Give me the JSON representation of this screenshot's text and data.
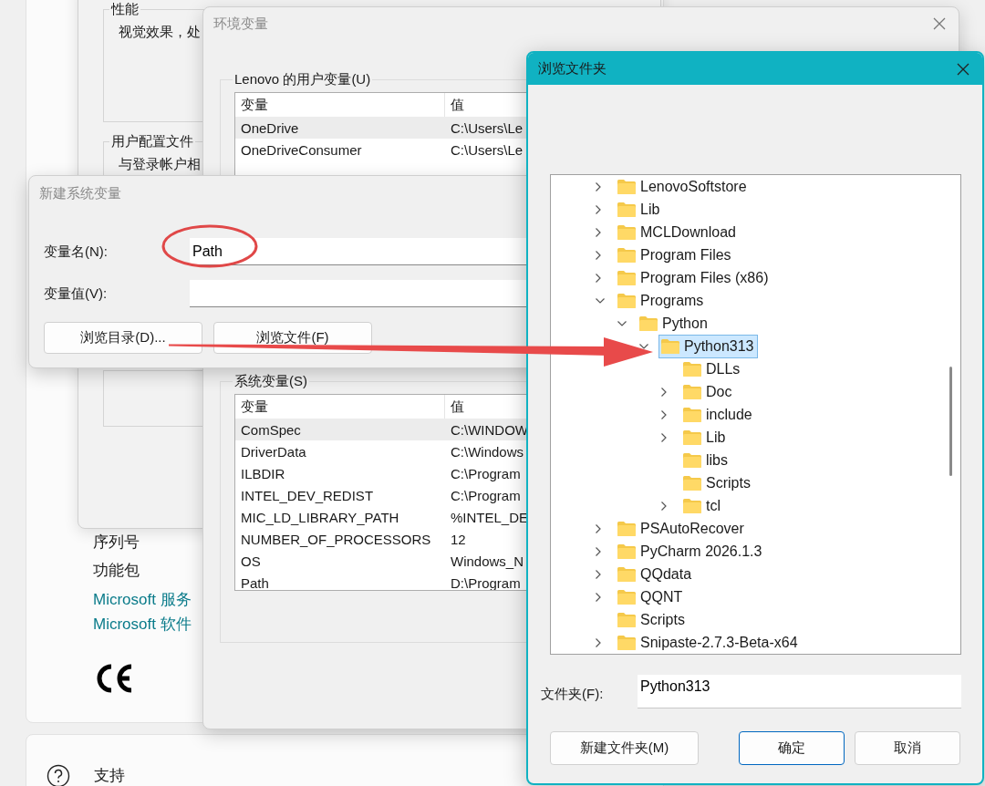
{
  "settings": {
    "about_items": [
      "序列号",
      "功能包"
    ],
    "links": [
      "Microsoft 服务",
      "Microsoft 软件"
    ],
    "support": {
      "label": "支持"
    }
  },
  "system_properties": {
    "groups": [
      {
        "title": "性能",
        "text": "视觉效果，处"
      },
      {
        "title": "用户配置文件",
        "text": "与登录帐户相"
      }
    ]
  },
  "env_dialog": {
    "title": "环境变量",
    "user_vars": {
      "title": "Lenovo 的用户变量(U)",
      "columns": [
        "变量",
        "值"
      ],
      "rows": [
        {
          "name": "OneDrive",
          "value": "C:\\Users\\Le",
          "selected": true
        },
        {
          "name": "OneDriveConsumer",
          "value": "C:\\Users\\Le",
          "selected": false
        }
      ]
    },
    "system_vars": {
      "title": "系统变量(S)",
      "columns": [
        "变量",
        "值"
      ],
      "rows": [
        {
          "name": "ComSpec",
          "value": "C:\\WINDOW",
          "selected": true
        },
        {
          "name": "DriverData",
          "value": "C:\\Windows",
          "selected": false
        },
        {
          "name": "ILBDIR",
          "value": "C:\\Program",
          "selected": false
        },
        {
          "name": "INTEL_DEV_REDIST",
          "value": "C:\\Program",
          "selected": false
        },
        {
          "name": "MIC_LD_LIBRARY_PATH",
          "value": "%INTEL_DE",
          "selected": false
        },
        {
          "name": "NUMBER_OF_PROCESSORS",
          "value": "12",
          "selected": false
        },
        {
          "name": "OS",
          "value": "Windows_N",
          "selected": false
        },
        {
          "name": "Path",
          "value": "D:\\Program",
          "selected": false
        }
      ]
    }
  },
  "new_var_dialog": {
    "title": "新建系统变量",
    "name_label": "变量名(N):",
    "name_value": "Path",
    "value_label": "变量值(V):",
    "buttons": [
      "浏览目录(D)...",
      "浏览文件(F)"
    ]
  },
  "browse_dialog": {
    "title": "浏览文件夹",
    "tree": [
      {
        "label": "LenovoSoftstore",
        "expandable": true,
        "expanded": false,
        "selected": false
      },
      {
        "label": "Lib",
        "expandable": true,
        "expanded": false,
        "selected": false
      },
      {
        "label": "MCLDownload",
        "expandable": true,
        "expanded": false,
        "selected": false
      },
      {
        "label": "Program Files",
        "expandable": true,
        "expanded": false,
        "selected": false
      },
      {
        "label": "Program Files (x86)",
        "expandable": true,
        "expanded": false,
        "selected": false
      },
      {
        "label": "Programs",
        "expandable": true,
        "expanded": true,
        "selected": false,
        "children": [
          {
            "label": "Python",
            "expandable": true,
            "expanded": true,
            "selected": false,
            "children": [
              {
                "label": "Python313",
                "expandable": true,
                "expanded": true,
                "selected": true,
                "children": [
                  {
                    "label": "DLLs",
                    "expandable": false,
                    "expanded": false,
                    "selected": false
                  },
                  {
                    "label": "Doc",
                    "expandable": true,
                    "expanded": false,
                    "selected": false
                  },
                  {
                    "label": "include",
                    "expandable": true,
                    "expanded": false,
                    "selected": false
                  },
                  {
                    "label": "Lib",
                    "expandable": true,
                    "expanded": false,
                    "selected": false
                  },
                  {
                    "label": "libs",
                    "expandable": false,
                    "expanded": false,
                    "selected": false
                  },
                  {
                    "label": "Scripts",
                    "expandable": false,
                    "expanded": false,
                    "selected": false
                  },
                  {
                    "label": "tcl",
                    "expandable": true,
                    "expanded": false,
                    "selected": false
                  }
                ]
              }
            ]
          }
        ]
      },
      {
        "label": "PSAutoRecover",
        "expandable": true,
        "expanded": false,
        "selected": false
      },
      {
        "label": "PyCharm 2026.1.3",
        "expandable": true,
        "expanded": false,
        "selected": false
      },
      {
        "label": "QQdata",
        "expandable": true,
        "expanded": false,
        "selected": false
      },
      {
        "label": "QQNT",
        "expandable": true,
        "expanded": false,
        "selected": false
      },
      {
        "label": "Scripts",
        "expandable": false,
        "expanded": false,
        "selected": false
      },
      {
        "label": "Snipaste-2.7.3-Beta-x64",
        "expandable": true,
        "expanded": false,
        "selected": false
      }
    ],
    "folder_label": "文件夹(F):",
    "folder_value": "Python313",
    "buttons": [
      "新建文件夹(M)",
      "确定",
      "取消"
    ]
  }
}
